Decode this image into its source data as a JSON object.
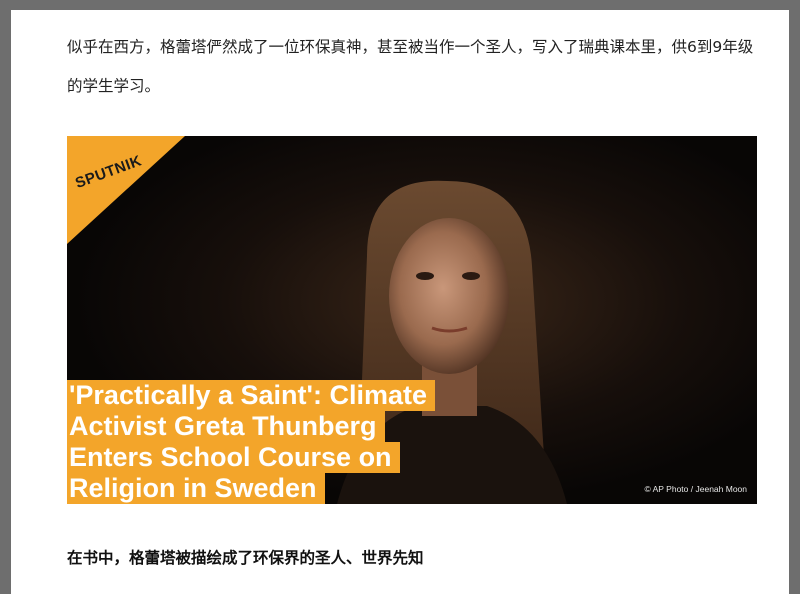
{
  "article": {
    "paragraph": "似乎在西方，格蕾塔俨然成了一位环保真神，甚至被当作一个圣人，写入了瑞典课本里，供6到9年级的学生学习。",
    "subheading": "在书中，格蕾塔被描绘成了环保界的圣人、世界先知"
  },
  "figure": {
    "logo_text": "SPUTNIK",
    "headline_lines": [
      "'Practically a Saint': Climate",
      "Activist Greta Thunberg",
      "Enters School Course on",
      "Religion in Sweden"
    ],
    "credit": "© AP Photo / Jeenah Moon",
    "accent_color": "#f3a52a"
  }
}
